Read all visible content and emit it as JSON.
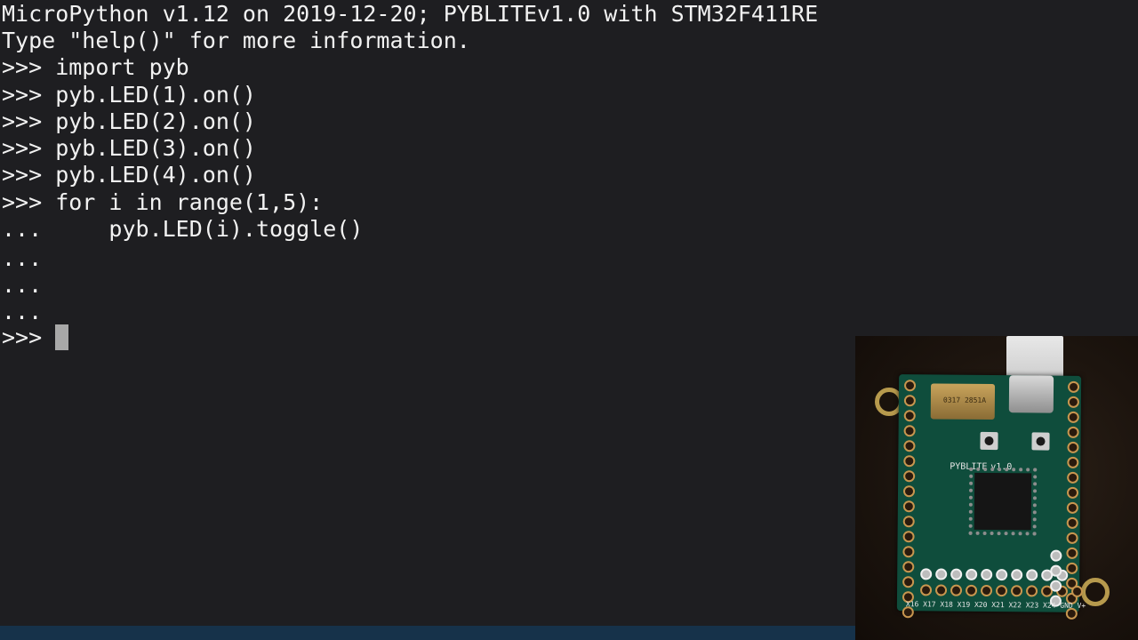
{
  "terminal": {
    "lines": [
      "MicroPython v1.12 on 2019-12-20; PYBLITEv1.0 with STM32F411RE",
      "Type \"help()\" for more information.",
      ">>> import pyb",
      ">>> pyb.LED(1).on()",
      ">>> pyb.LED(2).on()",
      ">>> pyb.LED(3).on()",
      ">>> pyb.LED(4).on()",
      ">>> for i in range(1,5):",
      "...     pyb.LED(i).toggle()",
      "...",
      "...",
      "...",
      ">>> "
    ]
  },
  "camera": {
    "board_label": "PYBLITE",
    "board_version": "v1.0",
    "sd_label": "0317 2851A",
    "pin_labels_bottom": "X16 X17 X18 X19 X20 X21 X22 X23 X24 GND V+"
  },
  "colors": {
    "terminal_bg": "#1e1e21",
    "terminal_fg": "#f2f2f2",
    "cursor": "#a8a8a8",
    "pcb": "#0f4d3c"
  }
}
